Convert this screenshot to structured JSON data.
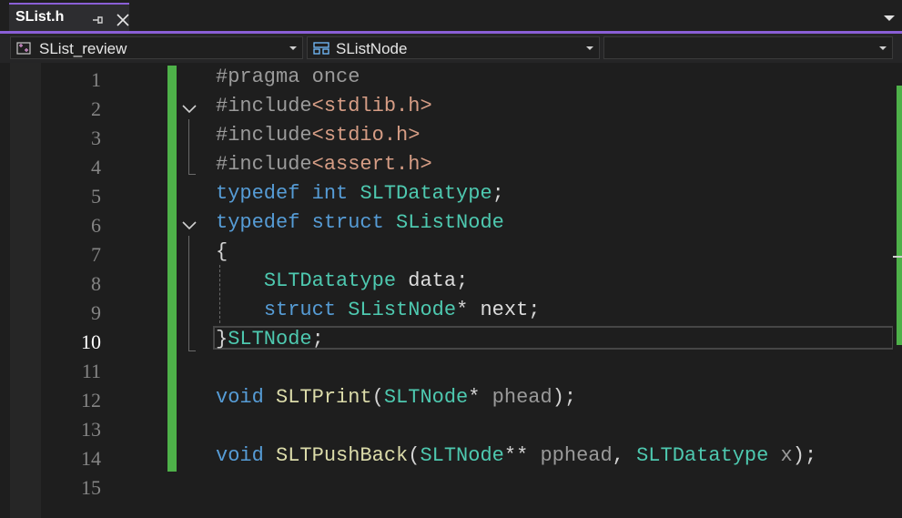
{
  "tabs": [
    {
      "label": "SList.h",
      "active": true
    }
  ],
  "navbar": {
    "project": "SList_review",
    "scope": "SListNode",
    "member": ""
  },
  "editor": {
    "current_line": 10,
    "line_numbers": [
      "1",
      "2",
      "3",
      "4",
      "5",
      "6",
      "7",
      "8",
      "9",
      "10",
      "11",
      "12",
      "13",
      "14",
      "15"
    ]
  },
  "code": {
    "l1_pp": "#pragma once",
    "l2_pp": "#include",
    "l2_str": "<stdlib.h>",
    "l3_pp": "#include",
    "l3_str": "<stdio.h>",
    "l4_pp": "#include",
    "l4_str": "<assert.h>",
    "l5_kw1": "typedef",
    "l5_kw2": "int",
    "l5_ty": "SLTDatatype",
    "l5_p": ";",
    "l6_kw1": "typedef",
    "l6_kw2": "struct",
    "l6_ty": "SListNode",
    "l7_p": "{",
    "l8_ty": "SLTDatatype",
    "l8_id": "data",
    "l8_p": ";",
    "l9_kw": "struct",
    "l9_ty": "SListNode",
    "l9_p1": "*",
    "l9_id": "next",
    "l9_p2": ";",
    "l10_p1": "}",
    "l10_ty": "SLTNode",
    "l10_p2": ";",
    "l12_kw": "void",
    "l12_fn": "SLTPrint",
    "l12_p1": "(",
    "l12_ty": "SLTNode",
    "l12_p2": "*",
    "l12_param": "phead",
    "l12_p3": ");",
    "l14_kw": "void",
    "l14_fn": "SLTPushBack",
    "l14_p1": "(",
    "l14_ty1": "SLTNode",
    "l14_p2": "**",
    "l14_param1": "pphead",
    "l14_p3": ",",
    "l14_ty2": "SLTDatatype",
    "l14_param2": "x",
    "l14_p4": ");"
  },
  "colors": {
    "accent": "#8a5fd6",
    "change_bar": "#4eb149",
    "keyword": "#569cd6",
    "type": "#4ec9b0",
    "function": "#dcdcaa",
    "string": "#d69d85",
    "preprocessor": "#9b9b9b"
  },
  "icons": {
    "pin": "pin-icon",
    "close": "close-icon",
    "project": "project-icon",
    "struct": "struct-icon",
    "fold": "fold-chevron-icon"
  }
}
